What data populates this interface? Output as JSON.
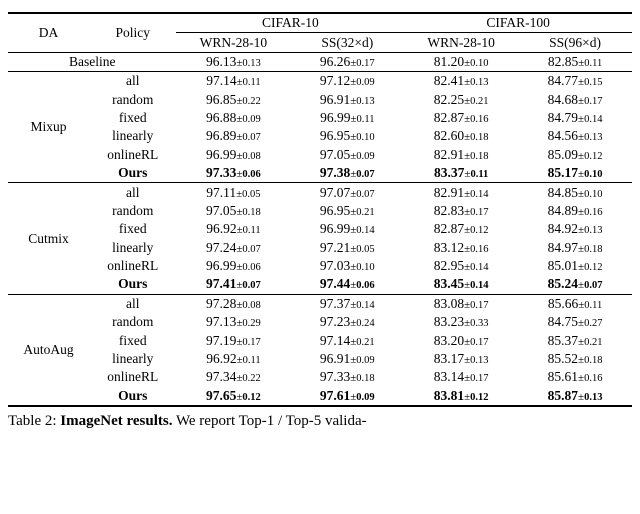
{
  "header": {
    "da": "DA",
    "policy": "Policy",
    "cifar10": "CIFAR-10",
    "cifar100": "CIFAR-100",
    "wrn": "WRN-28-10",
    "ss32": "SS(32×d)",
    "ss96": "SS(96×d)"
  },
  "baseline_label": "Baseline",
  "groups": [
    {
      "da": "Mixup",
      "rows": [
        {
          "policy": "all",
          "bold": false,
          "c10w": "97.14",
          "c10w_e": "0.11",
          "c10s": "97.12",
          "c10s_e": "0.09",
          "c100w": "82.41",
          "c100w_e": "0.13",
          "c100s": "84.77",
          "c100s_e": "0.15"
        },
        {
          "policy": "random",
          "bold": false,
          "c10w": "96.85",
          "c10w_e": "0.22",
          "c10s": "96.91",
          "c10s_e": "0.13",
          "c100w": "82.25",
          "c100w_e": "0.21",
          "c100s": "84.68",
          "c100s_e": "0.17"
        },
        {
          "policy": "fixed",
          "bold": false,
          "c10w": "96.88",
          "c10w_e": "0.09",
          "c10s": "96.99",
          "c10s_e": "0.11",
          "c100w": "82.87",
          "c100w_e": "0.16",
          "c100s": "84.79",
          "c100s_e": "0.14"
        },
        {
          "policy": "linearly",
          "bold": false,
          "c10w": "96.89",
          "c10w_e": "0.07",
          "c10s": "96.95",
          "c10s_e": "0.10",
          "c100w": "82.60",
          "c100w_e": "0.18",
          "c100s": "84.56",
          "c100s_e": "0.13"
        },
        {
          "policy": "onlineRL",
          "bold": false,
          "c10w": "96.99",
          "c10w_e": "0.08",
          "c10s": "97.05",
          "c10s_e": "0.09",
          "c100w": "82.91",
          "c100w_e": "0.18",
          "c100s": "85.09",
          "c100s_e": "0.12"
        },
        {
          "policy": "Ours",
          "bold": true,
          "c10w": "97.33",
          "c10w_e": "0.06",
          "c10s": "97.38",
          "c10s_e": "0.07",
          "c100w": "83.37",
          "c100w_e": "0.11",
          "c100s": "85.17",
          "c100s_e": "0.10"
        }
      ]
    },
    {
      "da": "Cutmix",
      "rows": [
        {
          "policy": "all",
          "bold": false,
          "c10w": "97.11",
          "c10w_e": "0.05",
          "c10s": "97.07",
          "c10s_e": "0.07",
          "c100w": "82.91",
          "c100w_e": "0.14",
          "c100s": "84.85",
          "c100s_e": "0.10"
        },
        {
          "policy": "random",
          "bold": false,
          "c10w": "97.05",
          "c10w_e": "0.18",
          "c10s": "96.95",
          "c10s_e": "0.21",
          "c100w": "82.83",
          "c100w_e": "0.17",
          "c100s": "84.89",
          "c100s_e": "0.16"
        },
        {
          "policy": "fixed",
          "bold": false,
          "c10w": "96.92",
          "c10w_e": "0.11",
          "c10s": "96.99",
          "c10s_e": "0.14",
          "c100w": "82.87",
          "c100w_e": "0.12",
          "c100s": "84.92",
          "c100s_e": "0.13"
        },
        {
          "policy": "linearly",
          "bold": false,
          "c10w": "97.24",
          "c10w_e": "0.07",
          "c10s": "97.21",
          "c10s_e": "0.05",
          "c100w": "83.12",
          "c100w_e": "0.16",
          "c100s": "84.97",
          "c100s_e": "0.18"
        },
        {
          "policy": "onlineRL",
          "bold": false,
          "c10w": "96.99",
          "c10w_e": "0.06",
          "c10s": "97.03",
          "c10s_e": "0.10",
          "c100w": "82.95",
          "c100w_e": "0.14",
          "c100s": "85.01",
          "c100s_e": "0.12"
        },
        {
          "policy": "Ours",
          "bold": true,
          "c10w": "97.41",
          "c10w_e": "0.07",
          "c10s": "97.44",
          "c10s_e": "0.06",
          "c100w": "83.45",
          "c100w_e": "0.14",
          "c100s": "85.24",
          "c100s_e": "0.07"
        }
      ]
    },
    {
      "da": "AutoAug",
      "rows": [
        {
          "policy": "all",
          "bold": false,
          "c10w": "97.28",
          "c10w_e": "0.08",
          "c10s": "97.37",
          "c10s_e": "0.14",
          "c100w": "83.08",
          "c100w_e": "0.17",
          "c100s": "85.66",
          "c100s_e": "0.11"
        },
        {
          "policy": "random",
          "bold": false,
          "c10w": "97.13",
          "c10w_e": "0.29",
          "c10s": "97.23",
          "c10s_e": "0.24",
          "c100w": "83.23",
          "c100w_e": "0.33",
          "c100s": "84.75",
          "c100s_e": "0.27"
        },
        {
          "policy": "fixed",
          "bold": false,
          "c10w": "97.19",
          "c10w_e": "0.17",
          "c10s": "97.14",
          "c10s_e": "0.21",
          "c100w": "83.20",
          "c100w_e": "0.17",
          "c100s": "85.37",
          "c100s_e": "0.21"
        },
        {
          "policy": "linearly",
          "bold": false,
          "c10w": "96.92",
          "c10w_e": "0.11",
          "c10s": "96.91",
          "c10s_e": "0.09",
          "c100w": "83.17",
          "c100w_e": "0.13",
          "c100s": "85.52",
          "c100s_e": "0.18"
        },
        {
          "policy": "onlineRL",
          "bold": false,
          "c10w": "97.34",
          "c10w_e": "0.22",
          "c10s": "97.33",
          "c10s_e": "0.18",
          "c100w": "83.14",
          "c100w_e": "0.17",
          "c100s": "85.61",
          "c100s_e": "0.16"
        },
        {
          "policy": "Ours",
          "bold": true,
          "c10w": "97.65",
          "c10w_e": "0.12",
          "c10s": "97.61",
          "c10s_e": "0.09",
          "c100w": "83.81",
          "c100w_e": "0.12",
          "c100s": "85.87",
          "c100s_e": "0.13"
        }
      ]
    }
  ],
  "baseline": {
    "c10w": "96.13",
    "c10w_e": "0.13",
    "c10s": "96.26",
    "c10s_e": "0.17",
    "c100w": "81.20",
    "c100w_e": "0.10",
    "c100s": "82.85",
    "c100s_e": "0.11"
  },
  "caption_prefix": "Table 2: ",
  "caption_bold": "ImageNet results.",
  "caption_rest": " We report Top-1 / Top-5 valida-",
  "chart_data": {
    "type": "table",
    "title": "CIFAR-10 / CIFAR-100 accuracy (mean ± std) across data-augmentation scheduling policies",
    "columns": [
      "DA",
      "Policy",
      "CIFAR-10 WRN-28-10",
      "CIFAR-10 SS(32×d)",
      "CIFAR-100 WRN-28-10",
      "CIFAR-100 SS(96×d)"
    ],
    "rows": [
      [
        "Baseline",
        "",
        "96.13±0.13",
        "96.26±0.17",
        "81.20±0.10",
        "82.85±0.11"
      ],
      [
        "Mixup",
        "all",
        "97.14±0.11",
        "97.12±0.09",
        "82.41±0.13",
        "84.77±0.15"
      ],
      [
        "Mixup",
        "random",
        "96.85±0.22",
        "96.91±0.13",
        "82.25±0.21",
        "84.68±0.17"
      ],
      [
        "Mixup",
        "fixed",
        "96.88±0.09",
        "96.99±0.11",
        "82.87±0.16",
        "84.79±0.14"
      ],
      [
        "Mixup",
        "linearly",
        "96.89±0.07",
        "96.95±0.10",
        "82.60±0.18",
        "84.56±0.13"
      ],
      [
        "Mixup",
        "onlineRL",
        "96.99±0.08",
        "97.05±0.09",
        "82.91±0.18",
        "85.09±0.12"
      ],
      [
        "Mixup",
        "Ours",
        "97.33±0.06",
        "97.38±0.07",
        "83.37±0.11",
        "85.17±0.10"
      ],
      [
        "Cutmix",
        "all",
        "97.11±0.05",
        "97.07±0.07",
        "82.91±0.14",
        "84.85±0.10"
      ],
      [
        "Cutmix",
        "random",
        "97.05±0.18",
        "96.95±0.21",
        "82.83±0.17",
        "84.89±0.16"
      ],
      [
        "Cutmix",
        "fixed",
        "96.92±0.11",
        "96.99±0.14",
        "82.87±0.12",
        "84.92±0.13"
      ],
      [
        "Cutmix",
        "linearly",
        "97.24±0.07",
        "97.21±0.05",
        "83.12±0.16",
        "84.97±0.18"
      ],
      [
        "Cutmix",
        "onlineRL",
        "96.99±0.06",
        "97.03±0.10",
        "82.95±0.14",
        "85.01±0.12"
      ],
      [
        "Cutmix",
        "Ours",
        "97.41±0.07",
        "97.44±0.06",
        "83.45±0.14",
        "85.24±0.07"
      ],
      [
        "AutoAug",
        "all",
        "97.28±0.08",
        "97.37±0.14",
        "83.08±0.17",
        "85.66±0.11"
      ],
      [
        "AutoAug",
        "random",
        "97.13±0.29",
        "97.23±0.24",
        "83.23±0.33",
        "84.75±0.27"
      ],
      [
        "AutoAug",
        "fixed",
        "97.19±0.17",
        "97.14±0.21",
        "83.20±0.17",
        "85.37±0.21"
      ],
      [
        "AutoAug",
        "linearly",
        "96.92±0.11",
        "96.91±0.09",
        "83.17±0.13",
        "85.52±0.18"
      ],
      [
        "AutoAug",
        "onlineRL",
        "97.34±0.22",
        "97.33±0.18",
        "83.14±0.17",
        "85.61±0.16"
      ],
      [
        "AutoAug",
        "Ours",
        "97.65±0.12",
        "97.61±0.09",
        "83.81±0.12",
        "85.87±0.13"
      ]
    ]
  }
}
